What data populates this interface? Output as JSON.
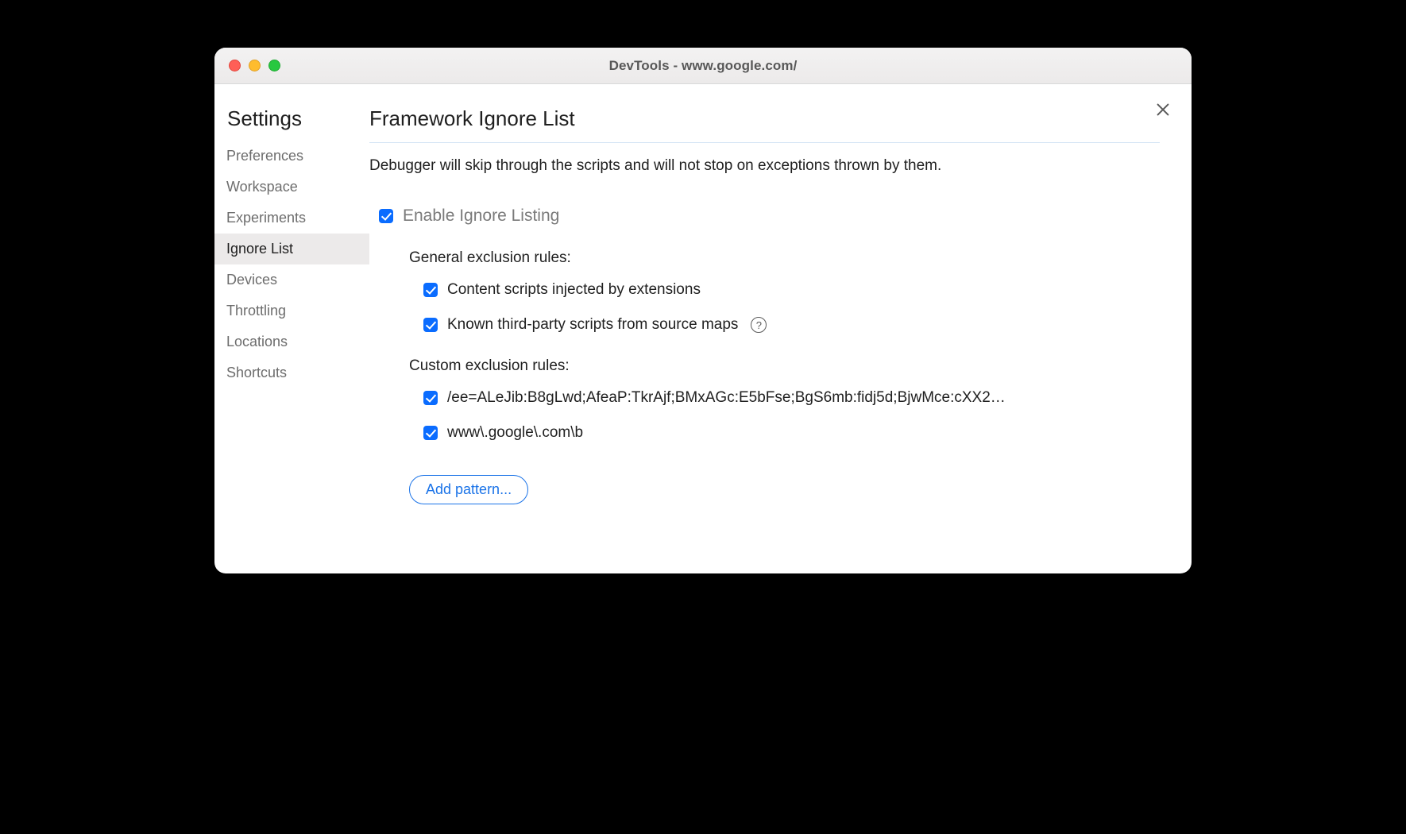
{
  "window": {
    "title": "DevTools - www.google.com/"
  },
  "sidebar": {
    "heading": "Settings",
    "items": [
      {
        "label": "Preferences",
        "active": false
      },
      {
        "label": "Workspace",
        "active": false
      },
      {
        "label": "Experiments",
        "active": false
      },
      {
        "label": "Ignore List",
        "active": true
      },
      {
        "label": "Devices",
        "active": false
      },
      {
        "label": "Throttling",
        "active": false
      },
      {
        "label": "Locations",
        "active": false
      },
      {
        "label": "Shortcuts",
        "active": false
      }
    ]
  },
  "page": {
    "title": "Framework Ignore List",
    "description": "Debugger will skip through the scripts and will not stop on exceptions thrown by them.",
    "enable_label": "Enable Ignore Listing",
    "general_header": "General exclusion rules:",
    "general_rules": [
      {
        "label": "Content scripts injected by extensions",
        "help": false
      },
      {
        "label": "Known third-party scripts from source maps",
        "help": true
      }
    ],
    "custom_header": "Custom exclusion rules:",
    "custom_rules": [
      {
        "label": "/ee=ALeJib:B8gLwd;AfeaP:TkrAjf;BMxAGc:E5bFse;BgS6mb:fidj5d;BjwMce:cXX2…"
      },
      {
        "label": "www\\.google\\.com\\b"
      }
    ],
    "add_button": "Add pattern..."
  }
}
